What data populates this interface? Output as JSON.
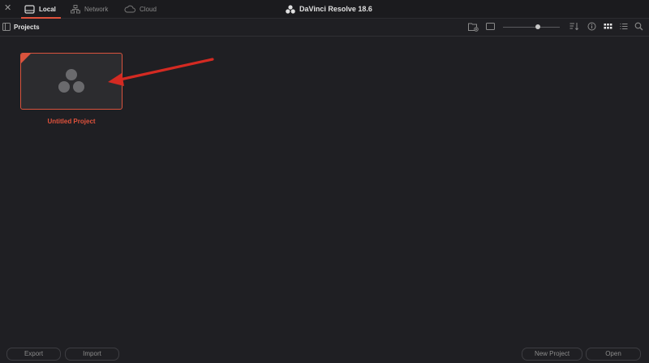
{
  "topbar": {
    "close_glyph": "✕",
    "tabs": [
      {
        "label": "Local",
        "icon": "drive-icon",
        "active": true
      },
      {
        "label": "Network",
        "icon": "network-icon",
        "active": false
      },
      {
        "label": "Cloud",
        "icon": "cloud-icon",
        "active": false
      }
    ],
    "app_title": "DaVinci Resolve 18.6"
  },
  "toolbar": {
    "title": "Projects",
    "zoom_slider_value": 0.62,
    "icons": [
      "panel-toggle-icon",
      "new-folder-icon",
      "thumbnail-view-icon",
      "sort-icon",
      "info-icon",
      "grid-view-icon",
      "list-view-icon",
      "search-icon"
    ]
  },
  "projects": [
    {
      "name": "Untitled Project",
      "selected": true
    }
  ],
  "footer": {
    "export_label": "Export",
    "import_label": "Import",
    "new_project_label": "New Project",
    "open_label": "Open"
  },
  "colors": {
    "accent": "#e0523c",
    "background": "#1f1f23",
    "annotation_arrow": "#d42a22"
  }
}
